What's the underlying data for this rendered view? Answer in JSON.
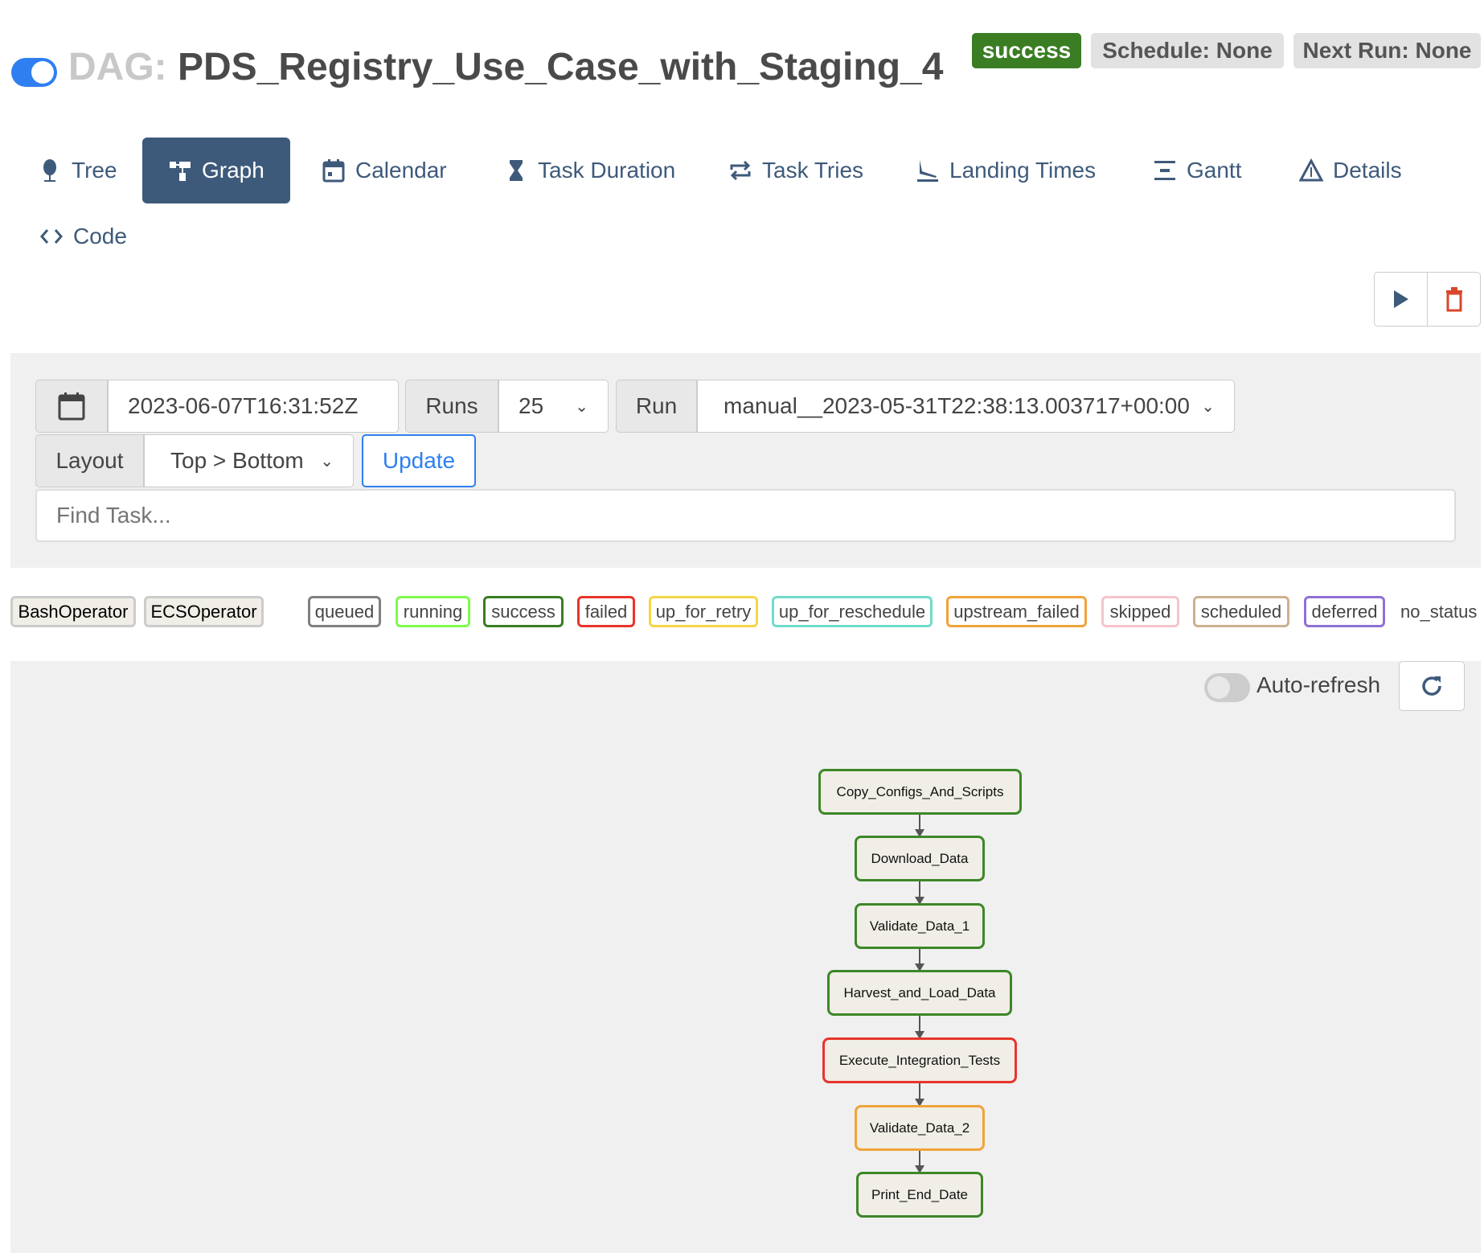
{
  "header": {
    "dag_prefix": "DAG:",
    "dag_id": "PDS_Registry_Use_Case_with_Staging_4",
    "paused_toggle_on": true,
    "badges": {
      "state": "success",
      "schedule": "Schedule: None",
      "next_run": "Next Run: None"
    }
  },
  "nav": {
    "tabs": [
      {
        "label": "Tree",
        "icon": "tree-icon"
      },
      {
        "label": "Graph",
        "icon": "graph-icon",
        "active": true
      },
      {
        "label": "Calendar",
        "icon": "calendar-icon"
      },
      {
        "label": "Task Duration",
        "icon": "hourglass-icon"
      },
      {
        "label": "Task Tries",
        "icon": "retry-icon"
      },
      {
        "label": "Landing Times",
        "icon": "plane-landing-icon"
      },
      {
        "label": "Gantt",
        "icon": "gantt-icon"
      },
      {
        "label": "Details",
        "icon": "warning-triangle-icon"
      },
      {
        "label": "Code",
        "icon": "code-icon"
      }
    ]
  },
  "actions": {
    "trigger": "play-icon",
    "delete": "trash-icon"
  },
  "form": {
    "base_date": "2023-06-07T16:31:52Z",
    "runs_label": "Runs",
    "runs_value": "25",
    "run_label": "Run",
    "run_value": "manual__2023-05-31T22:38:13.003717+00:00",
    "layout_label": "Layout",
    "layout_value": "Top > Bottom",
    "update_label": "Update",
    "find_placeholder": "Find Task..."
  },
  "legend": {
    "operators": [
      "BashOperator",
      "ECSOperator"
    ],
    "states": [
      {
        "label": "queued",
        "color": "#808080"
      },
      {
        "label": "running",
        "color": "#7cfc4c"
      },
      {
        "label": "success",
        "color": "#3a7d23"
      },
      {
        "label": "failed",
        "color": "#e8352b"
      },
      {
        "label": "up_for_retry",
        "color": "#f5d548"
      },
      {
        "label": "up_for_reschedule",
        "color": "#70dccb"
      },
      {
        "label": "upstream_failed",
        "color": "#f0a33a"
      },
      {
        "label": "skipped",
        "color": "#f5c4cb"
      },
      {
        "label": "scheduled",
        "color": "#cdb08f"
      },
      {
        "label": "deferred",
        "color": "#8e72d4"
      }
    ],
    "no_status": "no_status"
  },
  "graph": {
    "auto_refresh_label": "Auto-refresh",
    "auto_refresh_on": false,
    "nodes": [
      {
        "label": "Copy_Configs_And_Scripts",
        "state": "success"
      },
      {
        "label": "Download_Data",
        "state": "success"
      },
      {
        "label": "Validate_Data_1",
        "state": "success"
      },
      {
        "label": "Harvest_and_Load_Data",
        "state": "success"
      },
      {
        "label": "Execute_Integration_Tests",
        "state": "failed"
      },
      {
        "label": "Validate_Data_2",
        "state": "upstream_failed"
      },
      {
        "label": "Print_End_Date",
        "state": "success"
      }
    ]
  },
  "colors": {
    "accent": "#3e5a7b",
    "toggle": "#2f7ff0",
    "success": "#3a7d23",
    "node_success": "#3d8728",
    "node_failed": "#e8352b",
    "node_upstream_failed": "#f0a33a",
    "update": "#2f7ff0"
  }
}
